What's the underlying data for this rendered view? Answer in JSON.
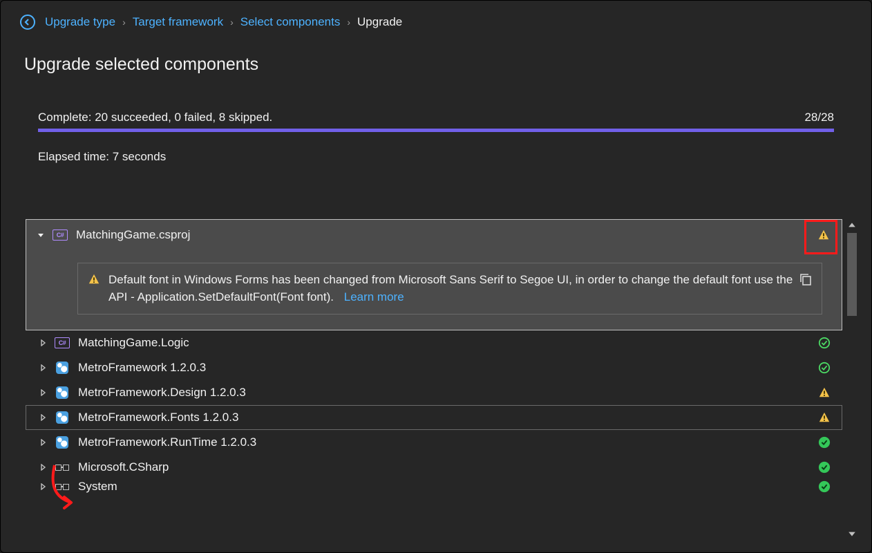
{
  "breadcrumb": {
    "items": [
      "Upgrade type",
      "Target framework",
      "Select components"
    ],
    "current": "Upgrade"
  },
  "title": "Upgrade selected components",
  "status": {
    "summary": "Complete: 20 succeeded, 0 failed, 8 skipped.",
    "counter": "28/28",
    "elapsed": "Elapsed time: 7 seconds"
  },
  "expanded": {
    "name": "MatchingGame.csproj",
    "status": "warning",
    "message": "Default font in Windows Forms has been changed from Microsoft Sans Serif to Segoe UI, in order to change the default font use the API - Application.SetDefaultFont(Font font).",
    "learn_more": "Learn more"
  },
  "items": [
    {
      "icon": "csharp",
      "label": "MatchingGame.Logic",
      "status": "ok"
    },
    {
      "icon": "nuget",
      "label": "MetroFramework 1.2.0.3",
      "status": "ok"
    },
    {
      "icon": "nuget",
      "label": "MetroFramework.Design 1.2.0.3",
      "status": "warning"
    },
    {
      "icon": "nuget",
      "label": "MetroFramework.Fonts 1.2.0.3",
      "status": "warning",
      "boxed": true
    },
    {
      "icon": "nuget",
      "label": "MetroFramework.RunTime 1.2.0.3",
      "status": "ok-filled"
    },
    {
      "icon": "ref",
      "label": "Microsoft.CSharp",
      "status": "ok-filled"
    },
    {
      "icon": "ref",
      "label": "System",
      "status": "ok-filled"
    }
  ],
  "colors": {
    "link": "#4db2ff",
    "accent": "#7160e8",
    "warning": "#f4c24a",
    "success": "#4cd964",
    "callout": "#ff1a1a"
  }
}
